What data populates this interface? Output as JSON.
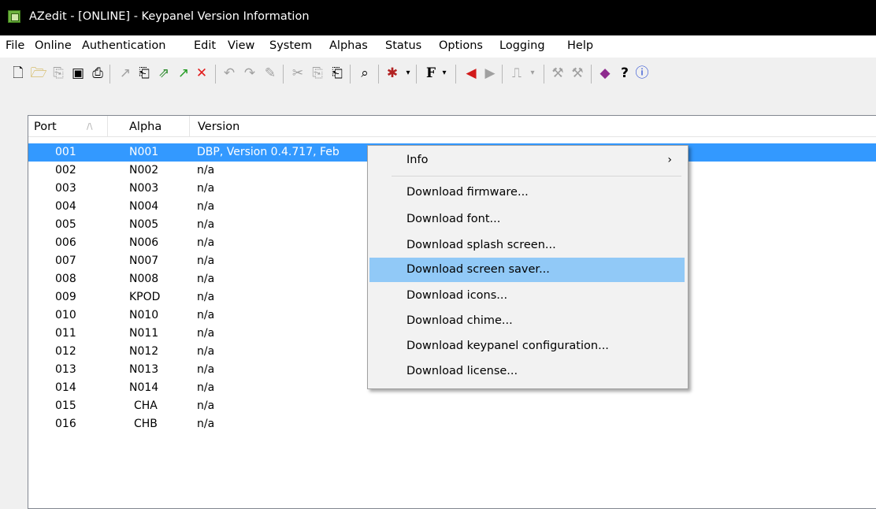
{
  "window": {
    "title": "AZedit - [ONLINE] - Keypanel Version Information"
  },
  "menu": [
    "File",
    "Online",
    "Authentication",
    "Edit",
    "View",
    "System",
    "Alphas",
    "Status",
    "Options",
    "Logging",
    "Help"
  ],
  "toolbar_icons": [
    "new-icon",
    "open-icon",
    "copy-doc-icon",
    "save-icon",
    "print-icon",
    "wand-icon",
    "paste-icon",
    "export-icon",
    "green-arrow-icon",
    "red-x-icon",
    "undo-icon",
    "redo-icon",
    "pen-icon",
    "cut-icon",
    "copy-icon",
    "paste2-icon",
    "find-icon",
    "bug-dropdown-icon",
    "font-dropdown-icon",
    "back-arrow-icon",
    "forward-arrow-icon",
    "usb-dropdown-icon",
    "hammer-icon",
    "hammer2-icon",
    "book-icon",
    "help-cursor-icon",
    "info-icon"
  ],
  "table": {
    "columns": [
      "Port",
      "Alpha",
      "Version"
    ],
    "rows": [
      {
        "port": "001",
        "alpha": "N001",
        "version": "DBP, Version 0.4.717, Feb"
      },
      {
        "port": "002",
        "alpha": "N002",
        "version": "n/a"
      },
      {
        "port": "003",
        "alpha": "N003",
        "version": "n/a"
      },
      {
        "port": "004",
        "alpha": "N004",
        "version": "n/a"
      },
      {
        "port": "005",
        "alpha": "N005",
        "version": "n/a"
      },
      {
        "port": "006",
        "alpha": "N006",
        "version": "n/a"
      },
      {
        "port": "007",
        "alpha": "N007",
        "version": "n/a"
      },
      {
        "port": "008",
        "alpha": "N008",
        "version": "n/a"
      },
      {
        "port": "009",
        "alpha": "KPOD",
        "version": "n/a"
      },
      {
        "port": "010",
        "alpha": "N010",
        "version": "n/a"
      },
      {
        "port": "011",
        "alpha": "N011",
        "version": "n/a"
      },
      {
        "port": "012",
        "alpha": "N012",
        "version": "n/a"
      },
      {
        "port": "013",
        "alpha": "N013",
        "version": "n/a"
      },
      {
        "port": "014",
        "alpha": "N014",
        "version": "n/a"
      },
      {
        "port": "015",
        "alpha": "CHA",
        "version": "n/a"
      },
      {
        "port": "016",
        "alpha": "CHB",
        "version": "n/a"
      }
    ],
    "selected_row": "001"
  },
  "context_menu": {
    "items": [
      {
        "label": "Info",
        "submenu": true
      },
      {
        "label": "Download firmware..."
      },
      {
        "label": "Download font..."
      },
      {
        "label": "Download splash screen..."
      },
      {
        "label": "Download screen saver...",
        "highlighted": true
      },
      {
        "label": "Download icons..."
      },
      {
        "label": "Download chime..."
      },
      {
        "label": "Download keypanel configuration..."
      },
      {
        "label": "Download license..."
      }
    ]
  },
  "colors": {
    "selection": "#3399ff",
    "menu_highlight": "#91c9f7",
    "titlebar": "#000000"
  }
}
